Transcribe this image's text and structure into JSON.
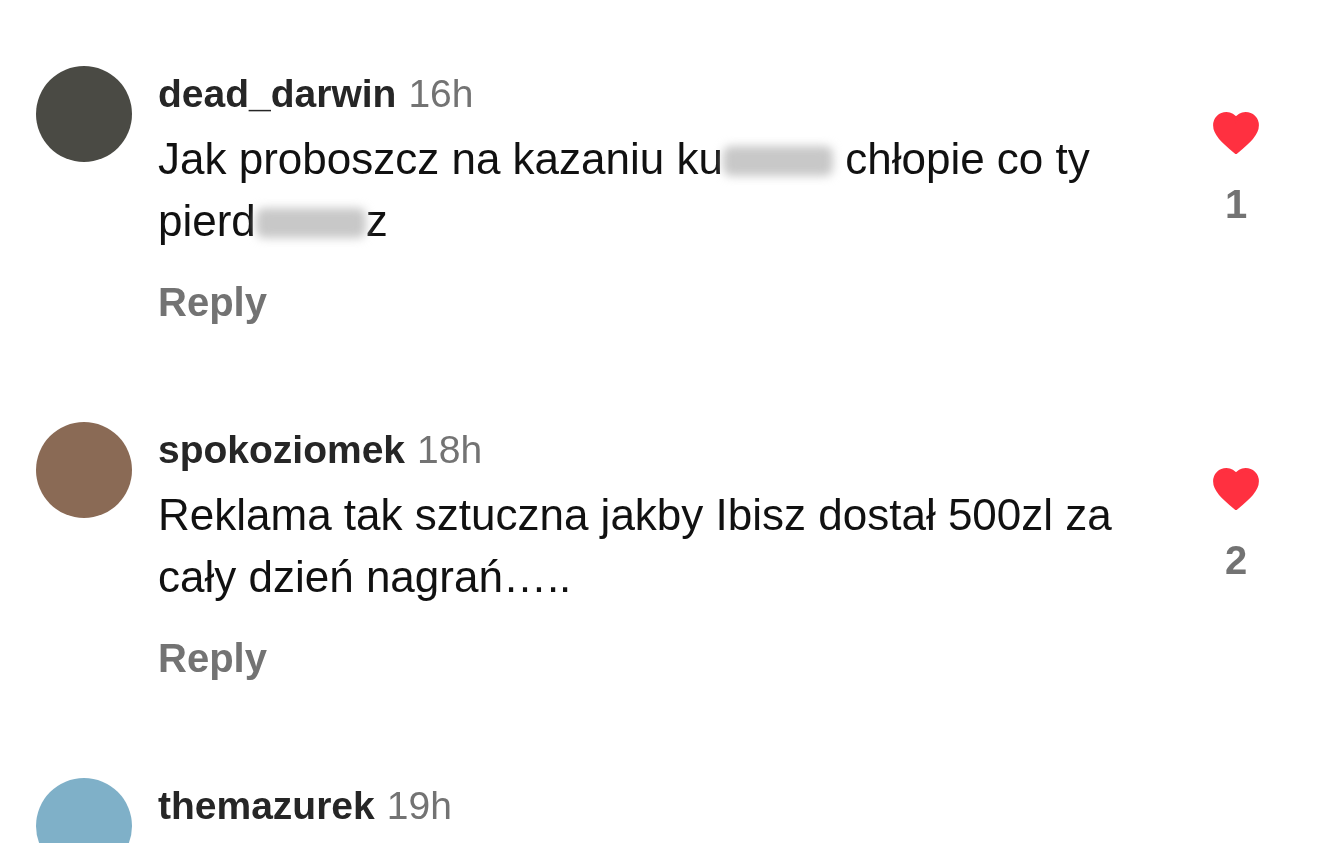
{
  "comments": [
    {
      "username": "dead_darwin",
      "time": "16h",
      "body": [
        {
          "kind": "text",
          "text": "Jak proboszcz na kazaniu ku"
        },
        {
          "kind": "censored"
        },
        {
          "kind": "text",
          "text": " chłopie co ty pierd"
        },
        {
          "kind": "censored"
        },
        {
          "kind": "text",
          "text": "z"
        }
      ],
      "reply": "Reply",
      "liked": true,
      "likes": "1"
    },
    {
      "username": "spokoziomek",
      "time": "18h",
      "body": [
        {
          "kind": "text",
          "text": "Reklama tak sztuczna jakby Ibisz dostał 500zl za cały dzień nagrań….."
        }
      ],
      "reply": "Reply",
      "liked": true,
      "likes": "2"
    },
    {
      "username": "themazurek",
      "time": "19h"
    }
  ]
}
